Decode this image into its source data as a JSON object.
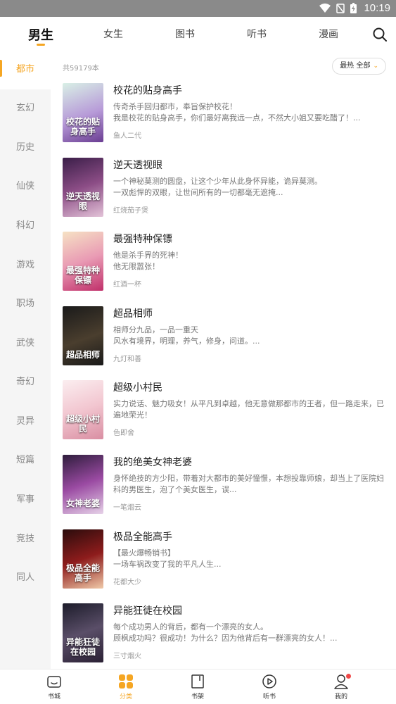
{
  "status_bar": {
    "time": "10:19"
  },
  "top_tabs": {
    "tabs": [
      {
        "label": "男生"
      },
      {
        "label": "女生"
      },
      {
        "label": "图书"
      },
      {
        "label": "听书"
      },
      {
        "label": "漫画"
      }
    ],
    "active_index": 0
  },
  "colors": {
    "accent": "#f5a623",
    "badge": "#f04848"
  },
  "sidebar": {
    "items": [
      {
        "label": "都市"
      },
      {
        "label": "玄幻"
      },
      {
        "label": "历史"
      },
      {
        "label": "仙侠"
      },
      {
        "label": "科幻"
      },
      {
        "label": "游戏"
      },
      {
        "label": "职场"
      },
      {
        "label": "武侠"
      },
      {
        "label": "奇幻"
      },
      {
        "label": "灵异"
      },
      {
        "label": "短篇"
      },
      {
        "label": "军事"
      },
      {
        "label": "竞技"
      },
      {
        "label": "同人"
      }
    ],
    "active_index": 0
  },
  "list": {
    "count": "共59179本",
    "sort_label": "最热 全部"
  },
  "books": [
    {
      "title": "校花的贴身高手",
      "desc": "传奇杀手回归都市，奉旨保护校花！\n我是校花的贴身高手，你们最好离我远一点，不然大小姐又要吃醋了！...",
      "author": "鱼人二代",
      "cover_text": "校花的贴身高手"
    },
    {
      "title": "逆天透视眼",
      "desc": "一个神秘莫测的圆盘，让这个少年从此身怀异能，诡异莫测。\n一双彪悍的双眼，让世间所有的一切都毫无遮掩...",
      "author": "红烧茄子煲",
      "cover_text": "逆天透视眼"
    },
    {
      "title": "最强特种保镖",
      "desc": "他是杀手界的死神！\n他无限嚣张！",
      "author": "红酒一杯",
      "cover_text": "最强特种保镖"
    },
    {
      "title": "超品相师",
      "desc": "相师分九品，一品一重天\n风水有境界，明理，养气，修身，问道。...",
      "author": "九灯和善",
      "cover_text": "超品相师"
    },
    {
      "title": "超级小村民",
      "desc": "实力说话、魅力吸女！从平凡到卓越，他无意做那都市的王者，但一路走来，已遍地荣光！",
      "author": "色即舍",
      "cover_text": "超级小村民"
    },
    {
      "title": "我的绝美女神老婆",
      "desc": "身怀绝技的方少阳，带着对大都市的美好憧憬，本想投靠师娘，却当上了医院妇科的男医生，泡了个美女医生，误...",
      "author": "一笔烟云",
      "cover_text": "女神老婆"
    },
    {
      "title": "极品全能高手",
      "desc": "【最火爆畅销书】\n一场车祸改变了我的平凡人生...",
      "author": "花都大少",
      "cover_text": "极品全能高手"
    },
    {
      "title": "异能狂徒在校园",
      "desc": "每个成功男人的背后，都有一个漂亮的女人。\n顾枫成功吗？很成功！为什么？因为他背后有一群漂亮的女人！...",
      "author": "三寸烟火",
      "cover_text": "异能狂徒在校园"
    }
  ],
  "bottom_nav": {
    "items": [
      {
        "label": "书城",
        "icon": "bookstore-icon"
      },
      {
        "label": "分类",
        "icon": "category-icon"
      },
      {
        "label": "书架",
        "icon": "bookshelf-icon"
      },
      {
        "label": "听书",
        "icon": "listen-icon"
      },
      {
        "label": "我的",
        "icon": "profile-icon"
      }
    ],
    "active_index": 1
  }
}
